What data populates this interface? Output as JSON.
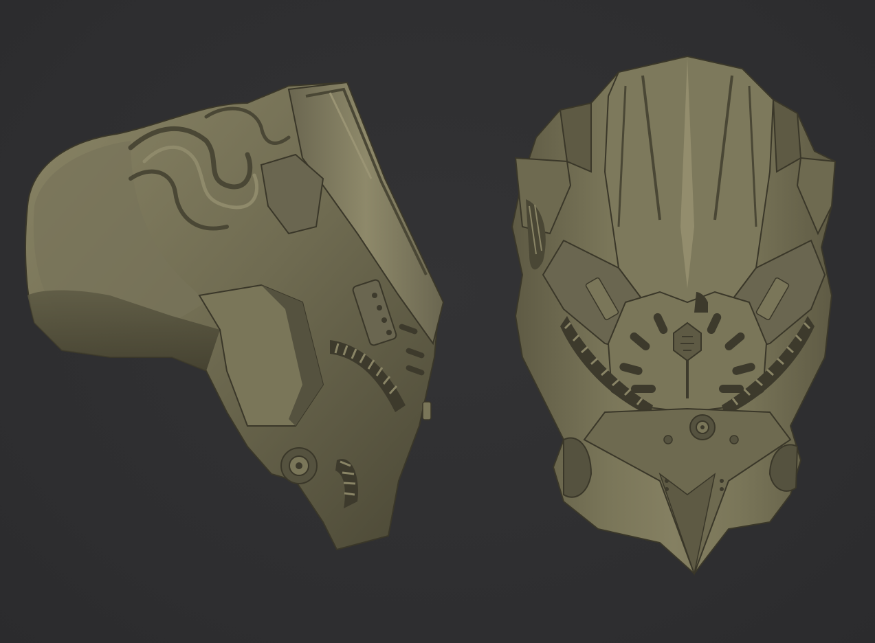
{
  "scene": {
    "background_color": "#2f2f31",
    "material_color": "#6f6b51",
    "material_highlight": "#8a8566",
    "material_shadow": "#3f3c2c",
    "cavity_tint": "#2c4a48",
    "models": [
      {
        "name": "helmet-side-view",
        "view": "side"
      },
      {
        "name": "helmet-front-view",
        "view": "front"
      }
    ]
  }
}
